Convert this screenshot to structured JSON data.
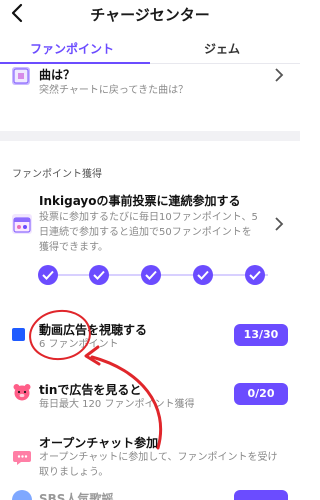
{
  "header": {
    "title": "チャージセンター"
  },
  "tabs": [
    {
      "label": "ファンポイント",
      "active": true
    },
    {
      "label": "ジェム",
      "active": false
    }
  ],
  "top_item": {
    "title": "曲は？",
    "subtitle": "突然チャートに戻ってきた曲は？"
  },
  "section": {
    "label": "ファンポイント獲得"
  },
  "items": [
    {
      "title": "Inkigayoの事前投票に連続参加する",
      "desc_lines": [
        "投票に参加するたびに毎日10ファンポイント、5",
        "日連続で参加すると追加で50ファンポイントを",
        "獲得できます。"
      ],
      "streak_days_completed": 5
    },
    {
      "title": "動画広告を視聴する",
      "subtitle": "6 ファンポイント",
      "button": "13/30"
    },
    {
      "title": "tinで広告を見ると",
      "subtitle": "毎日最大 120 ファンポイント獲得",
      "button": "0/20"
    },
    {
      "title": "オープンチャット参加",
      "desc_lines": [
        "オープンチャットに参加して、ファンポイントを受け",
        "取りましょう。"
      ]
    },
    {
      "title": "SBS人気歌謡"
    }
  ],
  "colors": {
    "accent": "#6b4cff",
    "annotation": "#e0262b"
  }
}
